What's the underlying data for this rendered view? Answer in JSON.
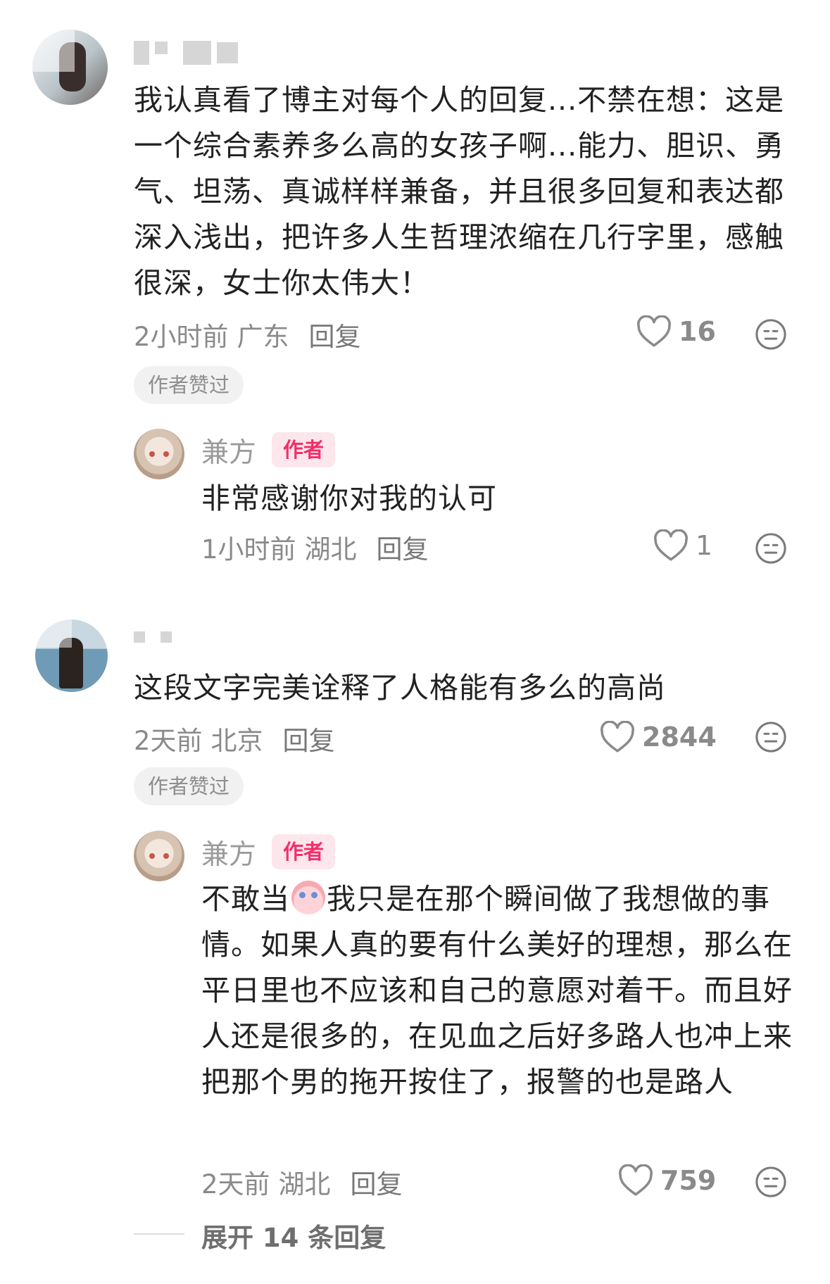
{
  "comments": [
    {
      "text": "我认真看了博主对每个人的回复...不禁在想：这是一个综合素养多么高的女孩子啊...能力、胆识、勇气、坦荡、真诚样样兼备，并且很多回复和表达都深入浅出，把许多人生哲理浓缩在几行字里，感触很深，女士你太伟大！",
      "time": "2小时前",
      "location": "广东",
      "reply_label": "回复",
      "likes": "16",
      "badge": "作者赞过",
      "replies": [
        {
          "author": "兼方",
          "author_tag": "作者",
          "text": "非常感谢你对我的认可",
          "time": "1小时前",
          "location": "湖北",
          "reply_label": "回复",
          "likes": "1"
        }
      ]
    },
    {
      "text": "这段文字完美诠释了人格能有多么的高尚",
      "time": "2天前",
      "location": "北京",
      "reply_label": "回复",
      "likes": "2844",
      "badge": "作者赞过",
      "replies": [
        {
          "author": "兼方",
          "author_tag": "作者",
          "text_before_emoji": "不敢当",
          "emoji": "crying-face-emoji",
          "text_after_emoji": "我只是在那个瞬间做了我想做的事情。如果人真的要有什么美好的理想，那么在平日里也不应该和自己的意愿对着干。而且好人还是很多的，在见血之后好多路人也冲上来把那个男的拖开按住了，报警的也是路人",
          "time": "2天前",
          "location": "湖北",
          "reply_label": "回复",
          "likes": "759"
        }
      ]
    }
  ],
  "expand_replies_label": "展开 14 条回复",
  "icons": {
    "like": "heart-outline-icon",
    "reaction": "neutral-face-icon"
  },
  "colors": {
    "author_tag_text": "#f0306a",
    "author_tag_bg": "#fde6ec",
    "meta_text": "#8a8a8a"
  }
}
